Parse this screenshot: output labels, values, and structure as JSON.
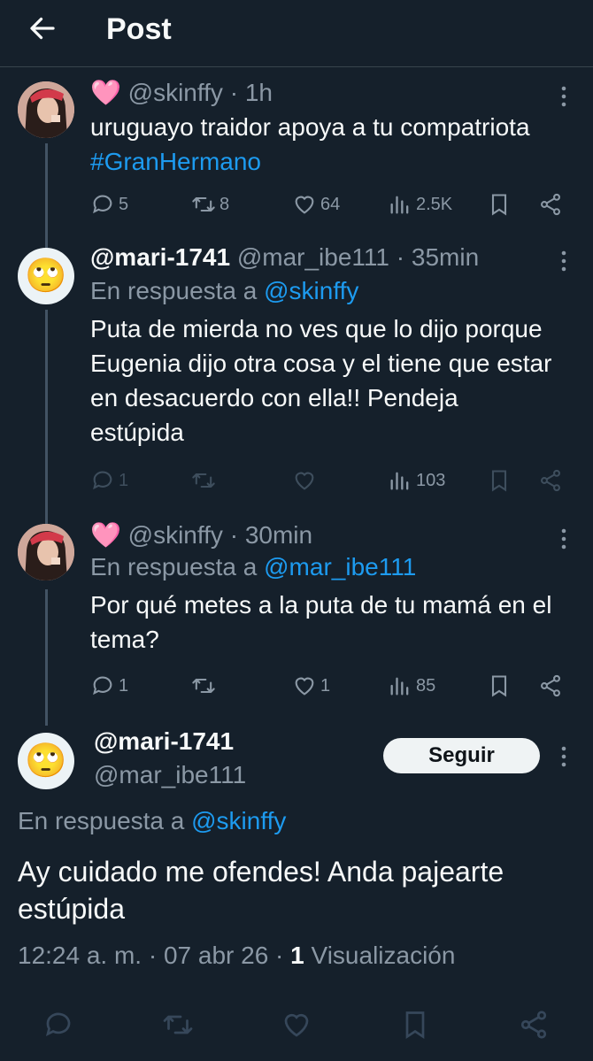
{
  "header": {
    "title": "Post"
  },
  "tweets": [
    {
      "name_emoji": "🩷",
      "handle": "@skinffy",
      "time": "· 1h",
      "text_main": "uruguayo traidor apoya a tu compatriota ",
      "hashtag": "#GranHermano",
      "counts": {
        "replies": "5",
        "reposts": "8",
        "likes": "64",
        "views": "2.5K"
      }
    },
    {
      "name": "@mari-1741",
      "handle": "@mar_ibe111",
      "time": "· 35min",
      "reply_prefix": "En respuesta a ",
      "reply_to": "@skinffy",
      "text": "Puta de mierda no ves que lo dijo porque Eugenia dijo otra cosa y el tiene que estar en desacuerdo con ella!! Pendeja estúpida",
      "counts": {
        "replies": "1",
        "views": "103"
      }
    },
    {
      "name_emoji": "🩷",
      "handle": "@skinffy",
      "time": "· 30min",
      "reply_prefix": "En respuesta a ",
      "reply_to": "@mar_ibe111",
      "text": "Por qué metes a la puta de tu mamá en el tema?",
      "counts": {
        "replies": "1",
        "likes": "1",
        "views": "85"
      }
    }
  ],
  "main_tweet": {
    "name": "@mari-1741",
    "handle": "@mar_ibe111",
    "follow_label": "Seguir",
    "reply_prefix": "En respuesta a ",
    "reply_to": "@skinffy",
    "text": "Ay cuidado me ofendes! Anda pajearte estúpida",
    "time": "12:24 a. m. · 07 abr 26 · ",
    "views_count": "1",
    "views_label": " Visualización"
  },
  "emoji_avatar": "🙄",
  "colors": {
    "background": "#15202b",
    "accent": "#1d9bf0",
    "muted": "#8b98a5",
    "follow_bg": "#eff3f4"
  }
}
